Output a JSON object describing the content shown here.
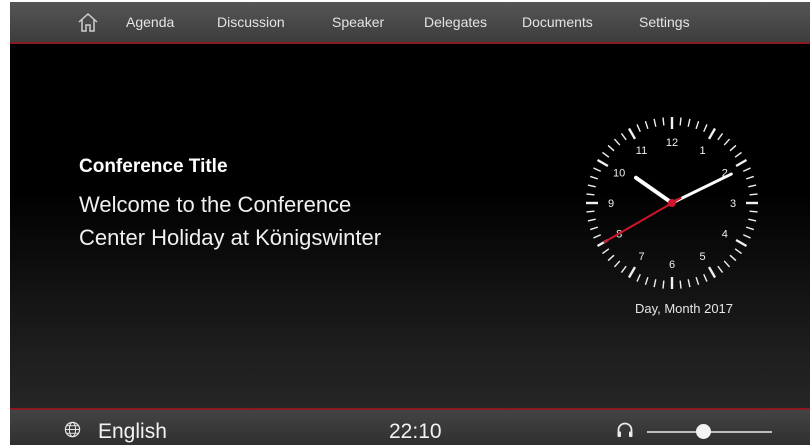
{
  "nav": {
    "home_icon": "home-icon",
    "items": [
      "Agenda",
      "Discussion",
      "Speaker",
      "Delegates",
      "Documents",
      "Settings"
    ]
  },
  "main": {
    "title": "Conference Title",
    "welcome_line1": "Welcome to the Conference",
    "welcome_line2": "Center Holiday at Königswinter"
  },
  "clock": {
    "numbers": [
      "12",
      "1",
      "2",
      "3",
      "4",
      "5",
      "6",
      "7",
      "8",
      "9",
      "10",
      "11"
    ],
    "hour": 10,
    "minute": 10,
    "second": 40,
    "date": "Day, Month 2017",
    "accent_color": "#d0142a"
  },
  "footer": {
    "globe_icon": "globe-icon",
    "language": "English",
    "time": "22:10",
    "headphone_icon": "headphone-icon",
    "volume": 0.45
  },
  "colors": {
    "accent": "#8a1a1f",
    "background": "#000000"
  }
}
